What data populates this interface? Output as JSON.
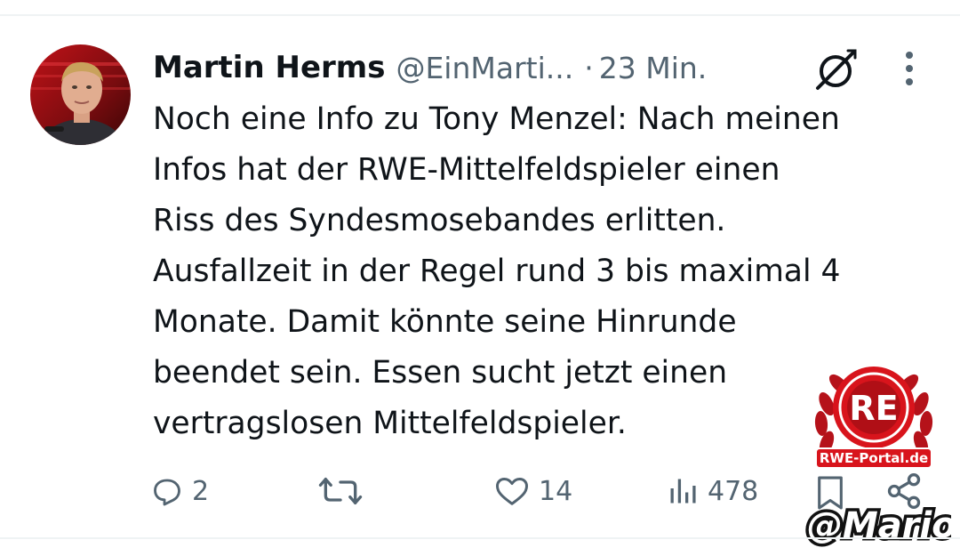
{
  "tweet": {
    "author_name": "Martin Herms",
    "handle": "@EinMarti...",
    "separator": "·",
    "time": "23 Min.",
    "text_lines": [
      "Noch eine Info zu Tony Menzel: Nach meinen",
      "Infos hat der RWE-Mittelfeldspieler einen",
      "Riss des Syndesmosebandes erlitten.",
      "Ausfallzeit in der Regel rund 3 bis maximal 4",
      "Monate. Damit könnte seine Hinrunde",
      "beendet sein. Essen sucht jetzt einen",
      "vertragslosen Mittelfeldspieler."
    ]
  },
  "actions": {
    "replies": "2",
    "reposts": "",
    "likes": "14",
    "views": "478"
  },
  "icons": {
    "reply": "reply-icon",
    "repost": "repost-icon",
    "like": "heart-icon",
    "views": "views-icon",
    "bookmark": "bookmark-icon",
    "share": "share-icon",
    "grok": "grok-icon",
    "more": "more-options-icon"
  },
  "overlay": {
    "logo_text": "RWE-Portal.de",
    "watermark_text": "@Mario"
  },
  "colors": {
    "text": "#0f1419",
    "secondary": "#536471",
    "divider": "#eff3f4",
    "logo_red": "#d8141c"
  }
}
